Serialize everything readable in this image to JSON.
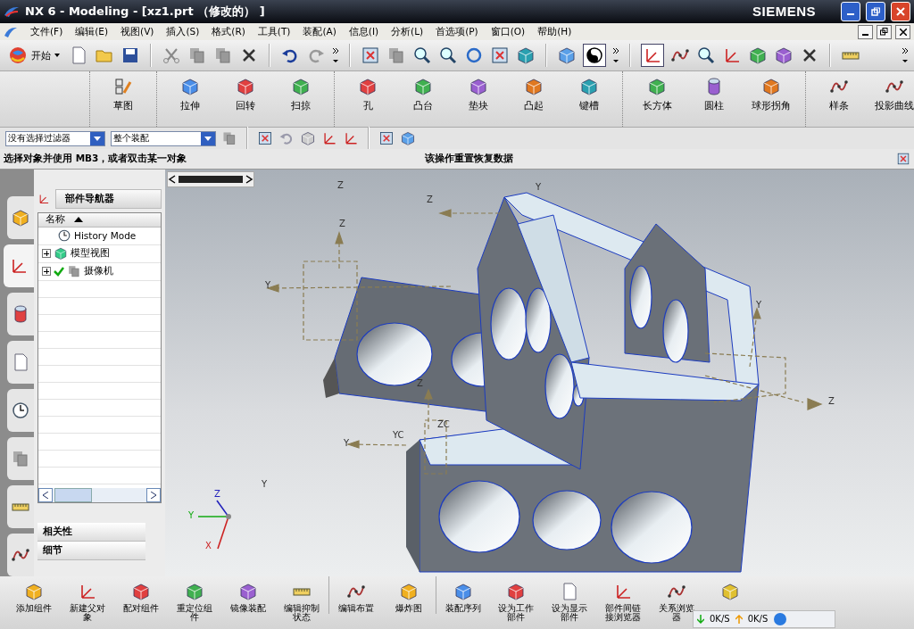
{
  "window": {
    "title": "NX 6 - Modeling - [xz1.prt （修改的） ]",
    "brand": "SIEMENS"
  },
  "menu": [
    "文件(F)",
    "编辑(E)",
    "视图(V)",
    "插入(S)",
    "格式(R)",
    "工具(T)",
    "装配(A)",
    "信息(I)",
    "分析(L)",
    "首选项(P)",
    "窗口(O)",
    "帮助(H)"
  ],
  "standard_toolbar": {
    "start_button": "开始"
  },
  "feature_toolbar": [
    {
      "group": [
        {
          "label": "草图"
        }
      ]
    },
    {
      "group": [
        {
          "label": "拉伸"
        },
        {
          "label": "回转"
        },
        {
          "label": "扫掠"
        }
      ]
    },
    {
      "group": [
        {
          "label": "孔"
        },
        {
          "label": "凸台"
        },
        {
          "label": "垫块"
        },
        {
          "label": "凸起"
        },
        {
          "label": "键槽"
        }
      ]
    },
    {
      "group": [
        {
          "label": "长方体"
        },
        {
          "label": "圆柱"
        },
        {
          "label": "球形拐角"
        }
      ]
    },
    {
      "group": [
        {
          "label": "样条"
        },
        {
          "label": "投影曲线"
        }
      ]
    }
  ],
  "selection_bar": {
    "filter": "没有选择过滤器",
    "scope": "整个装配"
  },
  "status_bar": {
    "prompt": "选择对象并使用 MB3，或者双击某一对象",
    "message": "该操作重置恢复数据"
  },
  "navigator": {
    "tabs": [
      {
        "selected": false
      },
      {
        "selected": true
      },
      {
        "selected": false
      },
      {
        "selected": false
      },
      {
        "selected": false
      },
      {
        "selected": false
      },
      {
        "selected": false
      },
      {
        "selected": false
      }
    ],
    "title": "部件导航器",
    "column": "名称",
    "items": [
      {
        "kind": "mode",
        "label": "History Mode",
        "checked": false
      },
      {
        "kind": "node",
        "label": "模型视图",
        "expanded": false,
        "checked": false
      },
      {
        "kind": "node",
        "label": "摄像机",
        "expanded": false,
        "checked": true
      }
    ],
    "panels": [
      "相关性",
      "细节"
    ]
  },
  "viewport": {
    "labels": [
      "Z",
      "Y",
      "Z",
      "Z",
      "Y",
      "Y",
      "Z",
      "ZC",
      "YC",
      "Y",
      "Y",
      "Z"
    ],
    "triad": [
      "Z",
      "Y",
      "X"
    ]
  },
  "assembly_toolbar": [
    {
      "label": "添加组件"
    },
    {
      "label": "新建父对象"
    },
    {
      "label": "配对组件"
    },
    {
      "label": "重定位组件"
    },
    {
      "label": "镜像装配"
    },
    {
      "label": "编辑抑制状态"
    },
    {
      "label": "编辑布置"
    },
    {
      "label": "爆炸图"
    },
    {
      "label": "装配序列"
    },
    {
      "label": "设为工作部件"
    },
    {
      "label": "设为显示部件"
    },
    {
      "label": "部件间链接浏览器"
    },
    {
      "label": "关系浏览器"
    }
  ],
  "net_meter": {
    "down": "0K/S",
    "up": "0K/S"
  }
}
